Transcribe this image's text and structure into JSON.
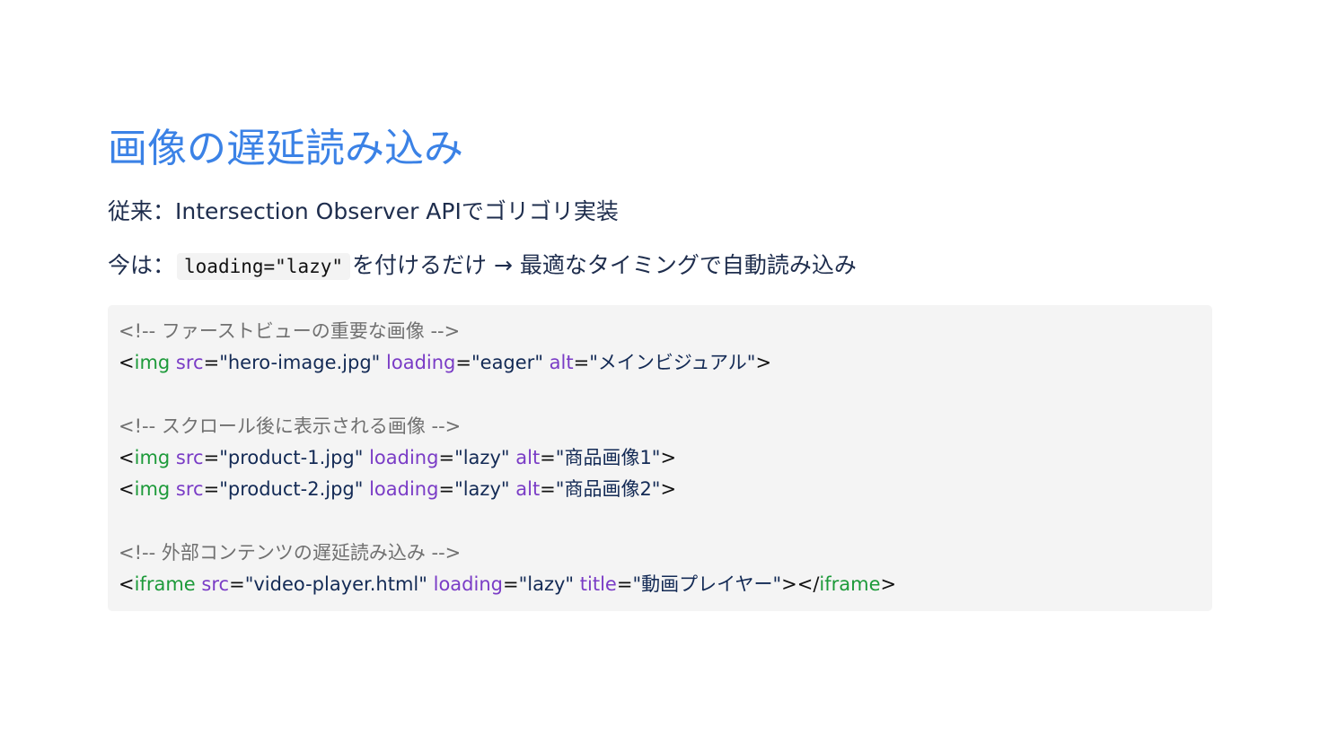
{
  "title": "画像の遅延読み込み",
  "line1": "従来：Intersection Observer APIでゴリゴリ実装",
  "line2": {
    "prefix": "今は：",
    "code": "loading=\"lazy\"",
    "suffix": "を付けるだけ → 最適なタイミングで自動読み込み"
  },
  "code": {
    "comment1": "<!-- ファーストビューの重要な画像 -->",
    "comment2": "<!-- スクロール後に表示される画像 -->",
    "comment3": "<!-- 外部コンテンツの遅延読み込み -->",
    "lt": "<",
    "gt": ">",
    "close_lt": "></",
    "eq": "=",
    "tag_img": "img",
    "tag_iframe": "iframe",
    "attr_src": "src",
    "attr_loading": "loading",
    "attr_alt": "alt",
    "attr_title": "title",
    "hero_src": "\"hero-image.jpg\"",
    "eager": "\"eager\"",
    "lazy": "\"lazy\"",
    "hero_alt": "\"メインビジュアル\"",
    "p1_src": "\"product-1.jpg\"",
    "p1_alt": "\"商品画像1\"",
    "p2_src": "\"product-2.jpg\"",
    "p2_alt": "\"商品画像2\"",
    "video_src": "\"video-player.html\"",
    "video_title": "\"動画プレイヤー\""
  },
  "colors": {
    "title": "#3b82e6",
    "text": "#1e2d4d",
    "comment": "#707070",
    "tag": "#1d9a3a",
    "attribute": "#7a3cc6",
    "string": "#132a55",
    "code_background": "#f4f4f4"
  }
}
